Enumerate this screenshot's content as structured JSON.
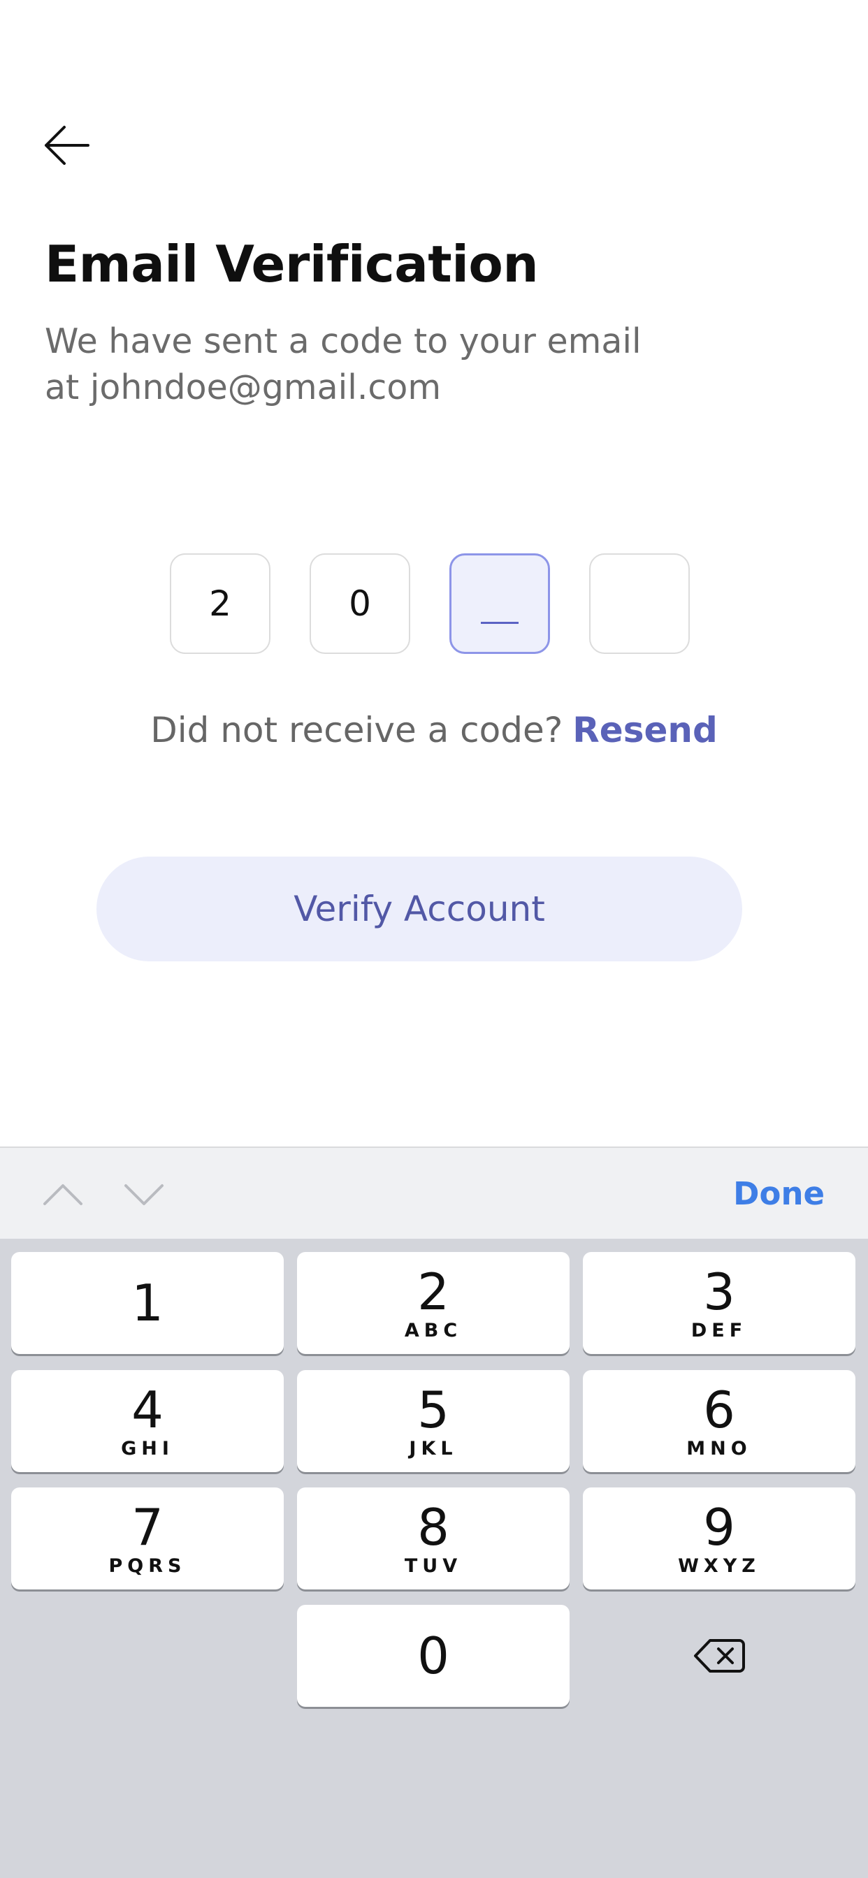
{
  "header": {
    "back_icon": "arrow-left-icon"
  },
  "main": {
    "title": "Email Verification",
    "subtitle_line1": "We have sent a code to your email",
    "subtitle_line2": "at johndoe@gmail.com",
    "code_digits": [
      "2",
      "0",
      "",
      ""
    ],
    "active_code_index": 2,
    "resend_prompt": "Did not receive a code?",
    "resend_label": "Resend",
    "verify_label": "Verify Account"
  },
  "keyboard": {
    "toolbar": {
      "prev_icon": "chevron-up-icon",
      "next_icon": "chevron-down-icon",
      "done_label": "Done"
    },
    "keys": [
      {
        "digit": "1",
        "letters": ""
      },
      {
        "digit": "2",
        "letters": "ABC"
      },
      {
        "digit": "3",
        "letters": "DEF"
      },
      {
        "digit": "4",
        "letters": "GHI"
      },
      {
        "digit": "5",
        "letters": "JKL"
      },
      {
        "digit": "6",
        "letters": "MNO"
      },
      {
        "digit": "7",
        "letters": "PQRS"
      },
      {
        "digit": "8",
        "letters": "TUV"
      },
      {
        "digit": "9",
        "letters": "WXYZ"
      },
      {
        "digit": "0",
        "letters": ""
      }
    ],
    "backspace_icon": "backspace-icon"
  },
  "colors": {
    "accent": "#5a62b8",
    "active_box_border": "#8d95e8",
    "button_bg": "#eceefb",
    "done_blue": "#3e7ee6",
    "keyboard_bg": "#d3d5db"
  }
}
